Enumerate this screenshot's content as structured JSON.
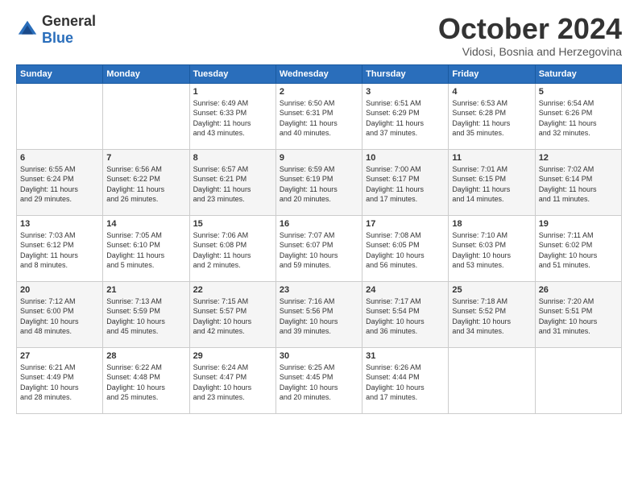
{
  "header": {
    "logo_general": "General",
    "logo_blue": "Blue",
    "month": "October 2024",
    "location": "Vidosi, Bosnia and Herzegovina"
  },
  "days_of_week": [
    "Sunday",
    "Monday",
    "Tuesday",
    "Wednesday",
    "Thursday",
    "Friday",
    "Saturday"
  ],
  "weeks": [
    [
      {
        "day": "",
        "info": ""
      },
      {
        "day": "",
        "info": ""
      },
      {
        "day": "1",
        "info": "Sunrise: 6:49 AM\nSunset: 6:33 PM\nDaylight: 11 hours\nand 43 minutes."
      },
      {
        "day": "2",
        "info": "Sunrise: 6:50 AM\nSunset: 6:31 PM\nDaylight: 11 hours\nand 40 minutes."
      },
      {
        "day": "3",
        "info": "Sunrise: 6:51 AM\nSunset: 6:29 PM\nDaylight: 11 hours\nand 37 minutes."
      },
      {
        "day": "4",
        "info": "Sunrise: 6:53 AM\nSunset: 6:28 PM\nDaylight: 11 hours\nand 35 minutes."
      },
      {
        "day": "5",
        "info": "Sunrise: 6:54 AM\nSunset: 6:26 PM\nDaylight: 11 hours\nand 32 minutes."
      }
    ],
    [
      {
        "day": "6",
        "info": "Sunrise: 6:55 AM\nSunset: 6:24 PM\nDaylight: 11 hours\nand 29 minutes."
      },
      {
        "day": "7",
        "info": "Sunrise: 6:56 AM\nSunset: 6:22 PM\nDaylight: 11 hours\nand 26 minutes."
      },
      {
        "day": "8",
        "info": "Sunrise: 6:57 AM\nSunset: 6:21 PM\nDaylight: 11 hours\nand 23 minutes."
      },
      {
        "day": "9",
        "info": "Sunrise: 6:59 AM\nSunset: 6:19 PM\nDaylight: 11 hours\nand 20 minutes."
      },
      {
        "day": "10",
        "info": "Sunrise: 7:00 AM\nSunset: 6:17 PM\nDaylight: 11 hours\nand 17 minutes."
      },
      {
        "day": "11",
        "info": "Sunrise: 7:01 AM\nSunset: 6:15 PM\nDaylight: 11 hours\nand 14 minutes."
      },
      {
        "day": "12",
        "info": "Sunrise: 7:02 AM\nSunset: 6:14 PM\nDaylight: 11 hours\nand 11 minutes."
      }
    ],
    [
      {
        "day": "13",
        "info": "Sunrise: 7:03 AM\nSunset: 6:12 PM\nDaylight: 11 hours\nand 8 minutes."
      },
      {
        "day": "14",
        "info": "Sunrise: 7:05 AM\nSunset: 6:10 PM\nDaylight: 11 hours\nand 5 minutes."
      },
      {
        "day": "15",
        "info": "Sunrise: 7:06 AM\nSunset: 6:08 PM\nDaylight: 11 hours\nand 2 minutes."
      },
      {
        "day": "16",
        "info": "Sunrise: 7:07 AM\nSunset: 6:07 PM\nDaylight: 10 hours\nand 59 minutes."
      },
      {
        "day": "17",
        "info": "Sunrise: 7:08 AM\nSunset: 6:05 PM\nDaylight: 10 hours\nand 56 minutes."
      },
      {
        "day": "18",
        "info": "Sunrise: 7:10 AM\nSunset: 6:03 PM\nDaylight: 10 hours\nand 53 minutes."
      },
      {
        "day": "19",
        "info": "Sunrise: 7:11 AM\nSunset: 6:02 PM\nDaylight: 10 hours\nand 51 minutes."
      }
    ],
    [
      {
        "day": "20",
        "info": "Sunrise: 7:12 AM\nSunset: 6:00 PM\nDaylight: 10 hours\nand 48 minutes."
      },
      {
        "day": "21",
        "info": "Sunrise: 7:13 AM\nSunset: 5:59 PM\nDaylight: 10 hours\nand 45 minutes."
      },
      {
        "day": "22",
        "info": "Sunrise: 7:15 AM\nSunset: 5:57 PM\nDaylight: 10 hours\nand 42 minutes."
      },
      {
        "day": "23",
        "info": "Sunrise: 7:16 AM\nSunset: 5:56 PM\nDaylight: 10 hours\nand 39 minutes."
      },
      {
        "day": "24",
        "info": "Sunrise: 7:17 AM\nSunset: 5:54 PM\nDaylight: 10 hours\nand 36 minutes."
      },
      {
        "day": "25",
        "info": "Sunrise: 7:18 AM\nSunset: 5:52 PM\nDaylight: 10 hours\nand 34 minutes."
      },
      {
        "day": "26",
        "info": "Sunrise: 7:20 AM\nSunset: 5:51 PM\nDaylight: 10 hours\nand 31 minutes."
      }
    ],
    [
      {
        "day": "27",
        "info": "Sunrise: 6:21 AM\nSunset: 4:49 PM\nDaylight: 10 hours\nand 28 minutes."
      },
      {
        "day": "28",
        "info": "Sunrise: 6:22 AM\nSunset: 4:48 PM\nDaylight: 10 hours\nand 25 minutes."
      },
      {
        "day": "29",
        "info": "Sunrise: 6:24 AM\nSunset: 4:47 PM\nDaylight: 10 hours\nand 23 minutes."
      },
      {
        "day": "30",
        "info": "Sunrise: 6:25 AM\nSunset: 4:45 PM\nDaylight: 10 hours\nand 20 minutes."
      },
      {
        "day": "31",
        "info": "Sunrise: 6:26 AM\nSunset: 4:44 PM\nDaylight: 10 hours\nand 17 minutes."
      },
      {
        "day": "",
        "info": ""
      },
      {
        "day": "",
        "info": ""
      }
    ]
  ]
}
